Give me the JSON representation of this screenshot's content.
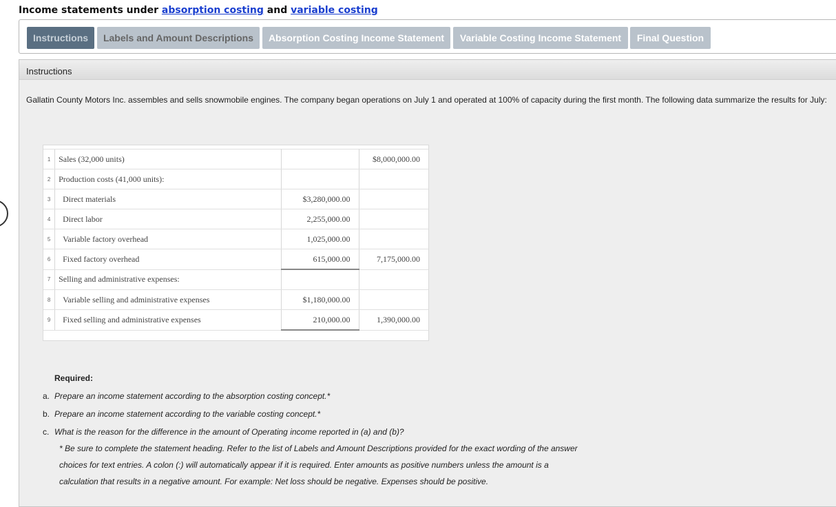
{
  "title": {
    "prefix": "Income statements under ",
    "link1": "absorption costing",
    "middle": " and ",
    "link2": "variable costing"
  },
  "tabs": [
    {
      "label": "Instructions"
    },
    {
      "label": "Labels and Amount Descriptions"
    },
    {
      "label": "Absorption Costing Income Statement"
    },
    {
      "label": "Variable Costing Income Statement"
    },
    {
      "label": "Final Question"
    }
  ],
  "panel": {
    "header": "Instructions",
    "intro": "Gallatin County Motors Inc. assembles and sells snowmobile engines. The company began operations on July 1 and operated at 100% of capacity during the first month. The following data summarize the results for July:"
  },
  "table": {
    "rows": [
      {
        "n": "1",
        "label": "Sales (32,000 units)",
        "c1": "",
        "c2": "$8,000,000.00"
      },
      {
        "n": "2",
        "label": "Production costs (41,000 units):",
        "c1": "",
        "c2": ""
      },
      {
        "n": "3",
        "label": "Direct materials",
        "c1": "$3,280,000.00",
        "c2": ""
      },
      {
        "n": "4",
        "label": "Direct labor",
        "c1": "2,255,000.00",
        "c2": ""
      },
      {
        "n": "5",
        "label": "Variable factory overhead",
        "c1": "1,025,000.00",
        "c2": ""
      },
      {
        "n": "6",
        "label": "Fixed factory overhead",
        "c1": "615,000.00",
        "c2": "7,175,000.00"
      },
      {
        "n": "7",
        "label": "Selling and administrative expenses:",
        "c1": "",
        "c2": ""
      },
      {
        "n": "8",
        "label": "Variable selling and administrative expenses",
        "c1": "$1,180,000.00",
        "c2": ""
      },
      {
        "n": "9",
        "label": "Fixed selling and administrative expenses",
        "c1": "210,000.00",
        "c2": "1,390,000.00"
      }
    ]
  },
  "required": {
    "title": "Required:",
    "items": [
      {
        "letter": "a.",
        "text": "Prepare an income statement according to the absorption costing concept.*"
      },
      {
        "letter": "b.",
        "text": "Prepare an income statement according to the variable costing concept.*"
      },
      {
        "letter": "c.",
        "text": "What is the reason for the difference in the amount of Operating income reported in (a) and (b)?"
      }
    ],
    "note_line1": "* Be sure to complete the statement heading. Refer to the list of Labels and Amount Descriptions provided for the exact wording of the answer",
    "note_line2": "choices for text entries. A colon (:) will automatically appear if it is required. Enter amounts as positive numbers unless the amount is a",
    "note_line3": "calculation that results in a negative amount. For example: Net loss should be negative. Expenses should be positive."
  }
}
